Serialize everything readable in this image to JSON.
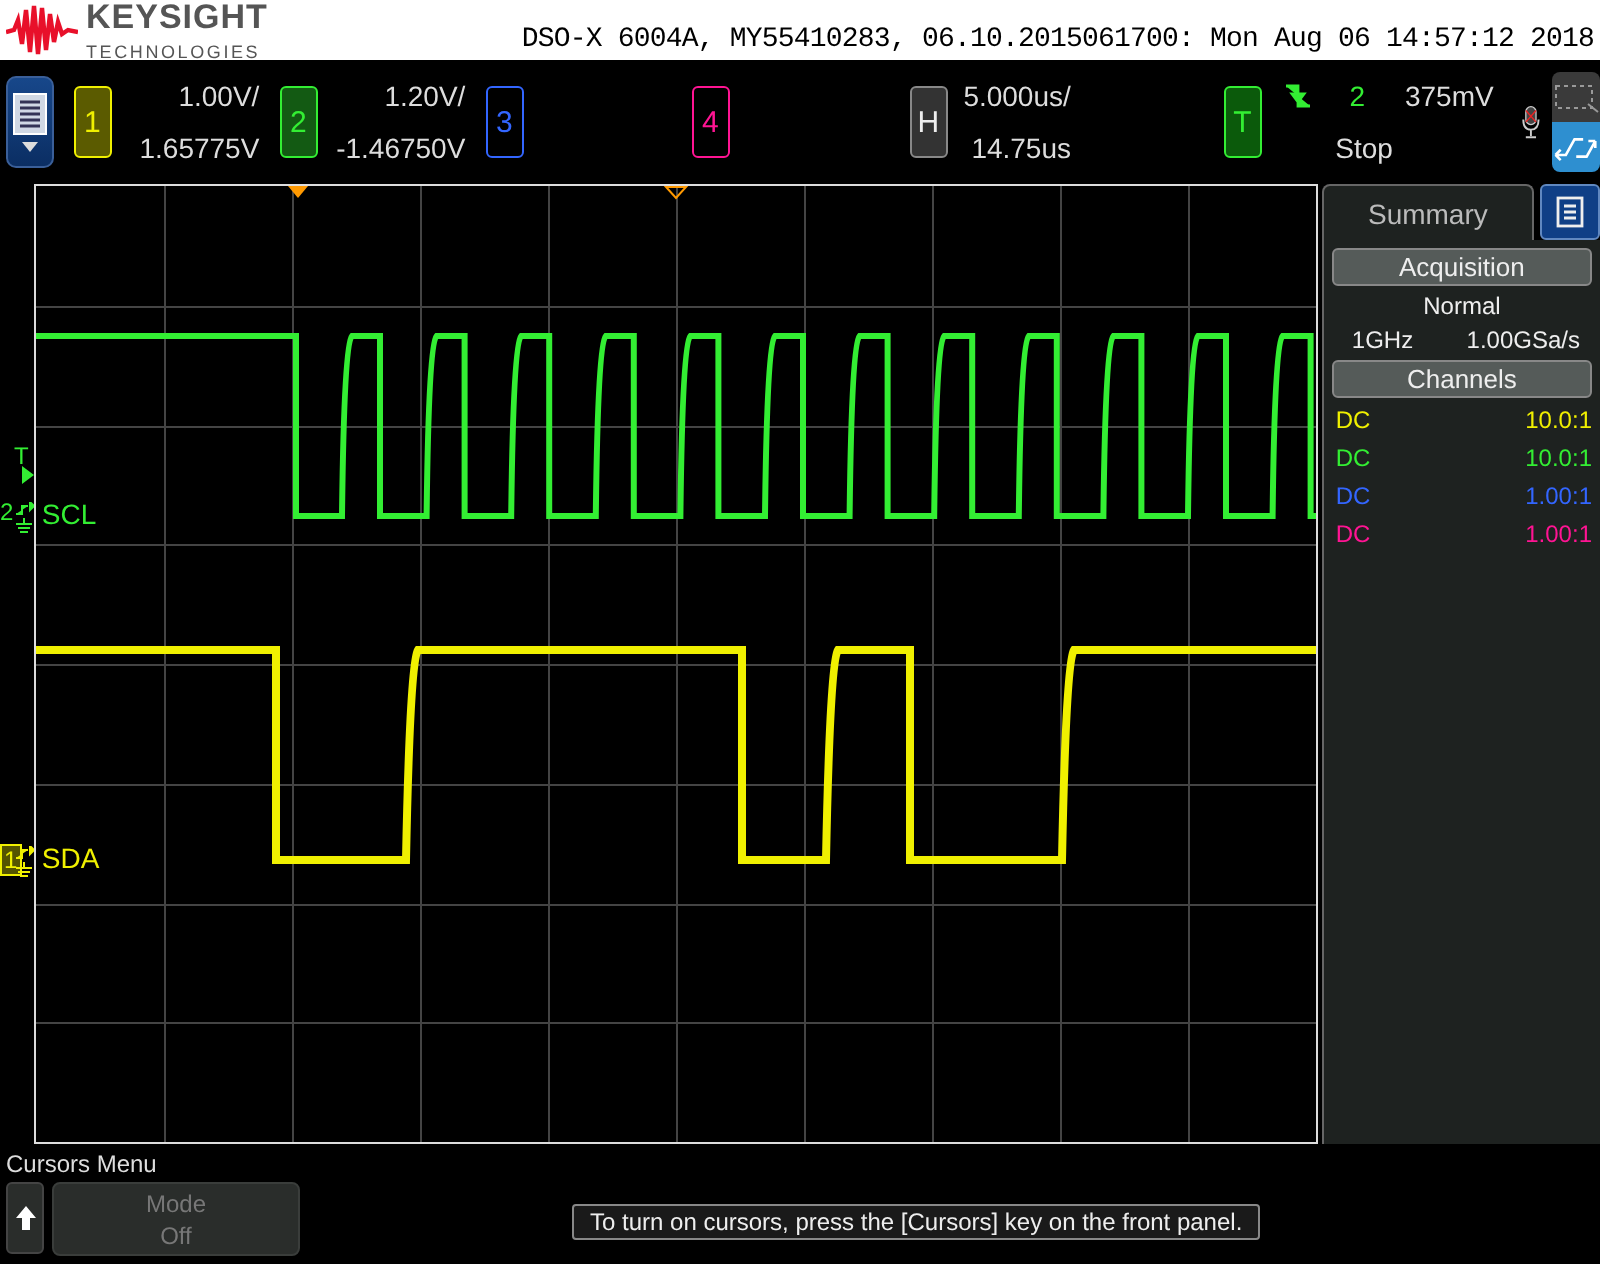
{
  "header": {
    "brand": "KEYSIGHT",
    "brand_sub": "TECHNOLOGIES",
    "title": "DSO-X 6004A, MY55410283, 06.10.2015061700: Mon Aug 06 14:57:12 2018"
  },
  "channels": [
    {
      "number": "1",
      "on": true,
      "color": "#f0f000",
      "scale": "1.00V/",
      "offset": "1.65775V"
    },
    {
      "number": "2",
      "on": true,
      "color": "#33ee33",
      "scale": "1.20V/",
      "offset": "-1.46750V"
    },
    {
      "number": "3",
      "on": false,
      "color": "#3366ff"
    },
    {
      "number": "4",
      "on": false,
      "color": "#ff1493"
    }
  ],
  "horizontal": {
    "key": "H",
    "scale": "5.000us/",
    "delay": "14.75us"
  },
  "trigger": {
    "key": "T",
    "source": "2",
    "level": "375mV",
    "status": "Stop",
    "marker": "T"
  },
  "waveforms": [
    {
      "channel": "2",
      "label": "SCL",
      "color": "#33ee33"
    },
    {
      "channel": "1",
      "label": "SDA",
      "color": "#f0f000"
    }
  ],
  "panel": {
    "tab": "Summary",
    "acquisition": "Acquisition",
    "mode": "Normal",
    "bandwidth": "1GHz",
    "sample_rate": "1.00GSa/s",
    "channels_header": "Channels",
    "rows": [
      {
        "coupling": "DC",
        "probe": "10.0:1",
        "color": "#f0f000"
      },
      {
        "coupling": "DC",
        "probe": "10.0:1",
        "color": "#33ee33"
      },
      {
        "coupling": "DC",
        "probe": "1.00:1",
        "color": "#3366ff"
      },
      {
        "coupling": "DC",
        "probe": "1.00:1",
        "color": "#ff1493"
      }
    ]
  },
  "softkeys": {
    "menu_title": "Cursors Menu",
    "keys": [
      {
        "label": "Mode",
        "value": "Off",
        "disabled": true
      }
    ]
  },
  "message": "To turn on cursors, press the [Cursors] key on the front panel."
}
